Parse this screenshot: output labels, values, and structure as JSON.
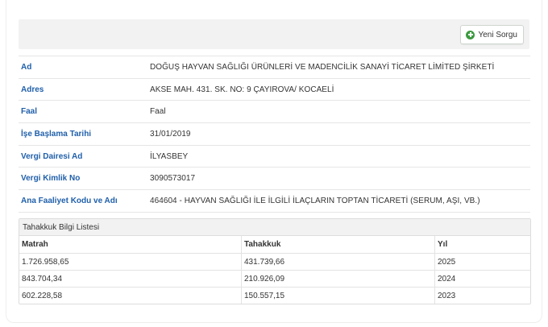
{
  "toolbar": {
    "new_query_label": "Yeni Sorgu",
    "new_query_icon": "plus-circle-icon",
    "icon_color": "#3c9a3f"
  },
  "info": [
    {
      "label": "Ad",
      "value": "DOĞUŞ HAYVAN SAĞLIĞI ÜRÜNLERİ VE MADENCİLİK SANAYİ TİCARET LİMİTED ŞİRKETİ"
    },
    {
      "label": "Adres",
      "value": "AKSE MAH. 431. SK. NO: 9 ÇAYIROVA/ KOCAELİ"
    },
    {
      "label": "Faal",
      "value": "Faal"
    },
    {
      "label": "İşe Başlama Tarihi",
      "value": "31/01/2019"
    },
    {
      "label": "Vergi Dairesi Ad",
      "value": "İLYASBEY"
    },
    {
      "label": "Vergi Kimlik No",
      "value": "3090573017"
    },
    {
      "label": "Ana Faaliyet Kodu ve Adı",
      "value": "464604 - HAYVAN SAĞLIĞI İLE İLGİLİ İLAÇLARIN TOPTAN TİCARETİ (SERUM, AŞI, VB.)"
    }
  ],
  "accrual": {
    "title": "Tahakkuk Bilgi Listesi",
    "columns": [
      "Matrah",
      "Tahakkuk",
      "Yıl"
    ],
    "rows": [
      [
        "1.726.958,65",
        "431.739,66",
        "2025"
      ],
      [
        "843.704,34",
        "210.926,09",
        "2024"
      ],
      [
        "602.228,58",
        "150.557,15",
        "2023"
      ]
    ]
  },
  "colors": {
    "label": "#1f5faa",
    "heading_bg": "#f2f2f2"
  }
}
